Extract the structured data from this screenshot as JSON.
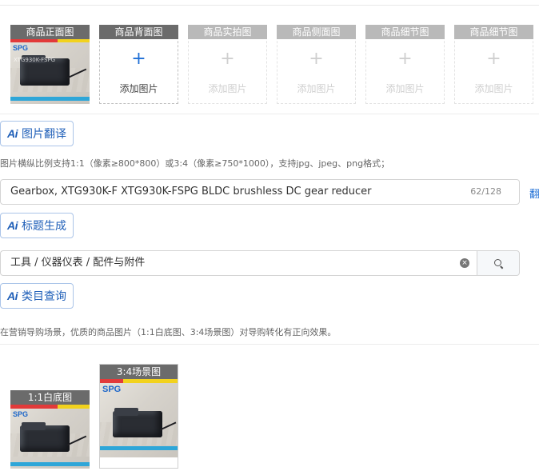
{
  "image_slots": [
    {
      "label": "商品正面图",
      "has_image": true
    },
    {
      "label": "商品背面图",
      "add_text": "添加图片",
      "enabled": true
    },
    {
      "label": "商品实拍图",
      "add_text": "添加图片",
      "enabled": false
    },
    {
      "label": "商品侧面图",
      "add_text": "添加图片",
      "enabled": false
    },
    {
      "label": "商品细节图",
      "add_text": "添加图片",
      "enabled": false
    },
    {
      "label": "商品细节图",
      "add_text": "添加图片",
      "enabled": false
    }
  ],
  "plus_symbol": "+",
  "image_translate": {
    "ai_icon": "Ai",
    "label": "图片翻译"
  },
  "image_hint": "图片横纵比例支持1:1（像素≥800*800）或3:4（像素≥750*1000），支持jpg、jpeg、png格式；",
  "title_field": {
    "value": "Gearbox, XTG930K-F XTG930K-FSPG BLDC brushless DC gear reducer",
    "counter": "62/128",
    "side_link": "翻"
  },
  "title_generate": {
    "ai_icon": "Ai",
    "label": "标题生成"
  },
  "category_field": {
    "value": "工具 / 仪器仪表 / 配件与附件",
    "clear_icon": "×"
  },
  "category_query": {
    "ai_icon": "Ai",
    "label": "类目查询"
  },
  "marketing_hint": "在营销导购场景，优质的商品图片（1:1白底图、3:4场景图）对导购转化有正向效果。",
  "marketing_images": [
    {
      "label": "1:1白底图"
    },
    {
      "label": "3:4场景图"
    }
  ],
  "photo_brand": "SPG",
  "colors": {
    "accent": "#1f6fd6",
    "label_bg": "#6b6b6b",
    "border": "#d4d4d4"
  }
}
